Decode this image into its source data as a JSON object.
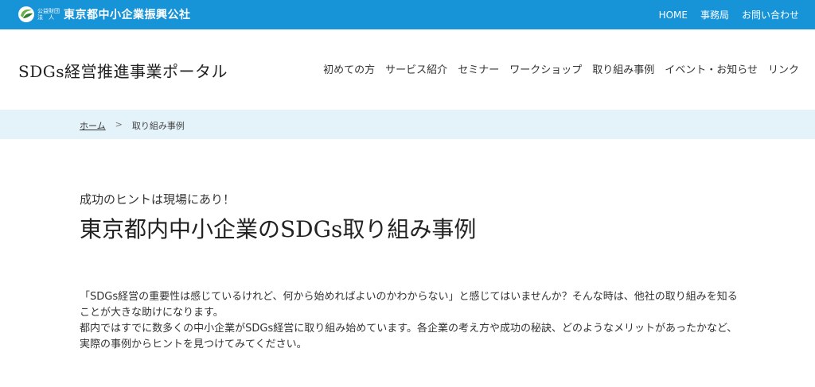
{
  "topbar": {
    "org_prefix_line1": "公益財団",
    "org_prefix_line2": "法　人",
    "org_name": "東京都中小企業振興公社",
    "links": [
      "HOME",
      "事務局",
      "お問い合わせ"
    ]
  },
  "header": {
    "site_title": "SDGs経営推進事業ポータル",
    "nav": [
      "初めての方",
      "サービス紹介",
      "セミナー",
      "ワークショップ",
      "取り組み事例",
      "イベント・お知らせ",
      "リンク"
    ]
  },
  "breadcrumb": {
    "home": "ホーム",
    "separator": ">",
    "current": "取り組み事例"
  },
  "main": {
    "lead": "成功のヒントは現場にあり！",
    "heading": "東京都内中小企業のSDGs取り組み事例",
    "paragraph1": "「SDGs経営の重要性は感じているけれど、何から始めればよいのかわからない」と感じてはいませんか？そんな時は、他社の取り組みを知ることが大きな助けになります。",
    "paragraph2": "都内ではすでに数多くの中小企業がSDGs経営に取り組み始めています。各企業の考え方や成功の秘訣、どのようなメリットがあったかなど、実際の事例からヒントを見つけてみてください。"
  },
  "colors": {
    "topbar": "#1793d8",
    "breadcrumb_bg": "#e4f3fa",
    "logo_green": "#6ab04c",
    "logo_dark": "#2e7d32"
  },
  "icons": {
    "org_logo": "org-logo-icon"
  }
}
